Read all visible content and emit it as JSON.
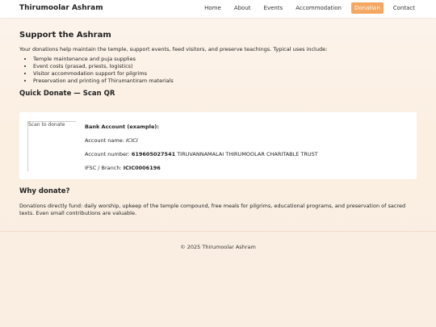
{
  "header": {
    "brand": "Thirumoolar Ashram",
    "nav": {
      "home": "Home",
      "about": "About",
      "events": "Events",
      "accommodation": "Accommodation",
      "donation": "Donation",
      "contact": "Contact"
    },
    "active_color": "#f3a761"
  },
  "main": {
    "title": "Support the Ashram",
    "intro": "Your donations help maintain the temple, support events, feed visitors, and preserve teachings. Typical uses include:",
    "uses": [
      "Temple maintenance and puja supplies",
      "Event costs (prasad, priests, logistics)",
      "Visitor accommodation support for pilgrims",
      "Preservation and printing of Thirumantiram materials"
    ],
    "quick_donate_title": "Quick Donate — Scan QR",
    "qr_alt": "Scan to donate",
    "bank": {
      "heading": "Bank Account (example):",
      "name_label": "Account name:",
      "name_value": "ICICI",
      "number_label": "Account number:",
      "number_value": "619605027541",
      "number_holder": "TIRUVANNAMALAI THIRUMOOLAR CHARITABLE TRUST",
      "ifsc_label": "IFSC / Branch:",
      "ifsc_value": "ICIC0006196"
    },
    "why_title": "Why donate?",
    "why_text": "Donations directly fund: daily worship, upkeep of the temple compound, free meals for pilgrims, educational programs, and preservation of sacred texts. Even small contributions are valuable."
  },
  "footer": {
    "copyright": "© 2025 Thirumoolar Ashram"
  }
}
